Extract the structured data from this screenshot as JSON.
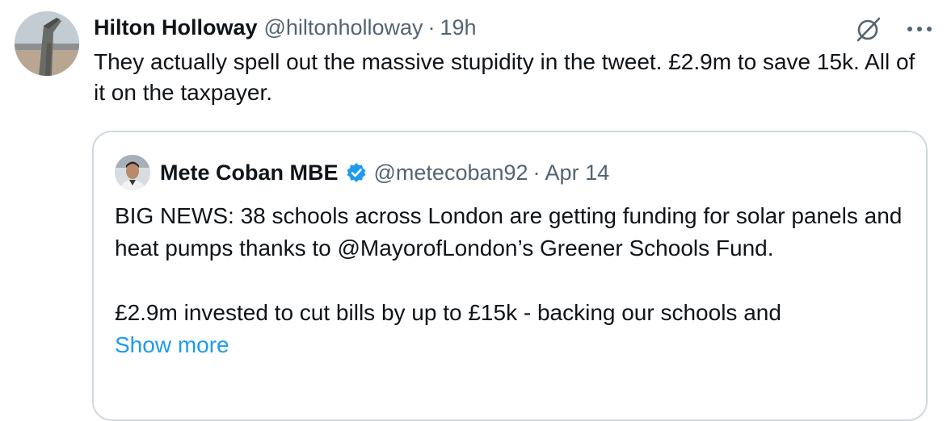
{
  "tweet": {
    "author_name": "Hilton Holloway",
    "author_handle": "@hiltonholloway",
    "separator": "·",
    "time": "19h",
    "text": "They actually spell out the massive stupidity in the tweet. £2.9m to save 15k. All of it on the taxpayer.",
    "icons": [
      "grok-icon",
      "more-options-icon"
    ]
  },
  "quoted_tweet": {
    "author_name": "Mete Coban MBE",
    "verified": true,
    "author_handle": "@metecoban92",
    "separator": "·",
    "time": "Apr 14",
    "paragraph_1": "BIG NEWS: 38 schools across London are getting funding for solar panels and heat pumps thanks to @MayorofLondon’s Greener Schools Fund.",
    "paragraph_2": "£2.9m invested to cut bills by up to £15k - backing our schools and",
    "show_more": "Show more"
  },
  "colors": {
    "primary_text": "#0f1419",
    "secondary_text": "#536471",
    "link": "#1d9bf0",
    "border": "#cfd9de",
    "verified_badge": "#1d9bf0"
  }
}
